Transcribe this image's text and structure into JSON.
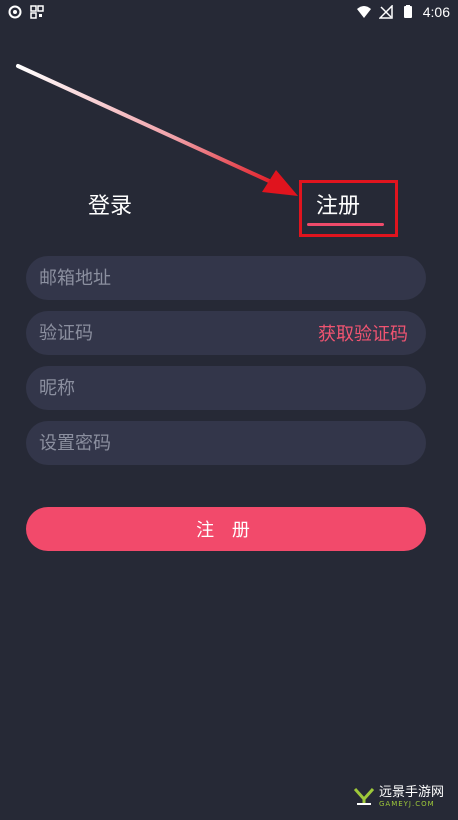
{
  "status_bar": {
    "time": "4:06",
    "left_icons": [
      "sync-icon",
      "qr-icon"
    ],
    "right_icons": [
      "wifi-icon",
      "no-signal-icon",
      "battery-icon"
    ]
  },
  "tabs": {
    "login": "登录",
    "register": "注册",
    "active": "register"
  },
  "form": {
    "email_placeholder": "邮箱地址",
    "code_placeholder": "验证码",
    "get_code_label": "获取验证码",
    "nickname_placeholder": "昵称",
    "password_placeholder": "设置密码"
  },
  "submit_label": "注 册",
  "watermark": {
    "text": "远景手游网",
    "sub": "GAMEYJ.COM"
  },
  "colors": {
    "background": "#262936",
    "field": "#33364a",
    "accent": "#f24a6b",
    "annotation": "#e0141e"
  }
}
